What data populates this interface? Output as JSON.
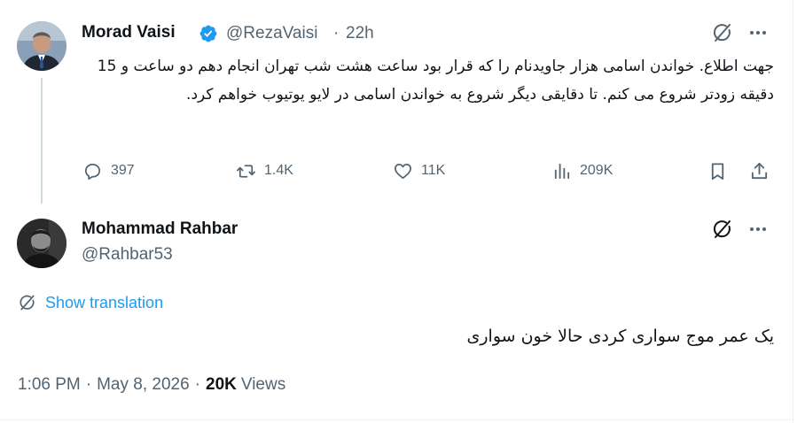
{
  "tweet": {
    "author_name": "Morad Vaisi",
    "author_handle": "@RezaVaisi",
    "separator": "·",
    "time_ago": "22h",
    "text": "جهت اطلاع. خواندن اسامی هزار جاویدنام را که قرار بود ساعت هشت شب تهران انجام دهم دو ساعت و 15 دقیقه زودتر شروع می کنم. تا دقایقی دیگر شروع به خواندن اسامی در لایو یوتیوب خواهم کرد.",
    "stats": {
      "replies": "397",
      "reposts": "1.4K",
      "likes": "11K",
      "views": "209K"
    },
    "icons": {
      "verified": "verified-badge-icon",
      "grok": "grok-icon",
      "more": "more-icon",
      "reply": "reply-icon",
      "repost": "repost-icon",
      "like": "heart-icon",
      "views": "views-icon",
      "bookmark": "bookmark-icon",
      "share": "share-icon"
    }
  },
  "reply": {
    "author_name": "Mohammad Rahbar",
    "author_handle": "@Rahbar53",
    "translate_label": "Show translation",
    "text": "یک عمر موج سواری کردی حالا خون سواری",
    "time": "1:06 PM",
    "separator": "·",
    "date": "May 8, 2026",
    "views_count": "20K",
    "views_label": "Views"
  },
  "colors": {
    "accent": "#1d9bf0",
    "secondary_text": "#536471",
    "primary_text": "#0f1419",
    "thread_line": "#cfd9de"
  }
}
